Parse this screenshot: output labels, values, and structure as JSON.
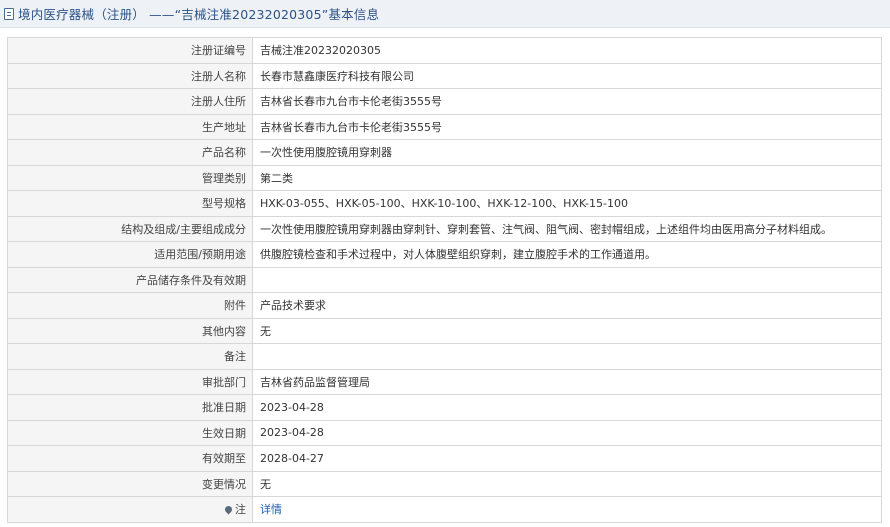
{
  "header": {
    "icon": "document-icon",
    "title": "境内医疗器械（注册） ——“吉械注准20232020305”基本信息"
  },
  "rows": [
    {
      "label": "注册证编号",
      "value": "吉械注准20232020305"
    },
    {
      "label": "注册人名称",
      "value": "长春市慧鑫康医疗科技有限公司"
    },
    {
      "label": "注册人住所",
      "value": "吉林省长春市九台市卡伦老街3555号"
    },
    {
      "label": "生产地址",
      "value": "吉林省长春市九台市卡伦老街3555号"
    },
    {
      "label": "产品名称",
      "value": "一次性使用腹腔镜用穿刺器"
    },
    {
      "label": "管理类别",
      "value": "第二类"
    },
    {
      "label": "型号规格",
      "value": "HXK-03-055、HXK-05-100、HXK-10-100、HXK-12-100、HXK-15-100"
    },
    {
      "label": "结构及组成/主要组成成分",
      "value": "一次性使用腹腔镜用穿刺器由穿刺针、穿刺套管、注气阀、阻气阀、密封帽组成，上述组件均由医用高分子材料组成。"
    },
    {
      "label": "适用范围/预期用途",
      "value": "供腹腔镜检查和手术过程中，对人体腹壁组织穿刺，建立腹腔手术的工作通道用。"
    },
    {
      "label": "产品储存条件及有效期",
      "value": ""
    },
    {
      "label": "附件",
      "value": "产品技术要求"
    },
    {
      "label": "其他内容",
      "value": "无"
    },
    {
      "label": "备注",
      "value": ""
    },
    {
      "label": "审批部门",
      "value": "吉林省药品监督管理局"
    },
    {
      "label": "批准日期",
      "value": "2023-04-28"
    },
    {
      "label": "生效日期",
      "value": "2023-04-28"
    },
    {
      "label": "有效期至",
      "value": "2028-04-27"
    },
    {
      "label": "变更情况",
      "value": "无"
    }
  ],
  "note_row": {
    "icon": "pin-icon",
    "label": "注",
    "link_text": "详情"
  }
}
